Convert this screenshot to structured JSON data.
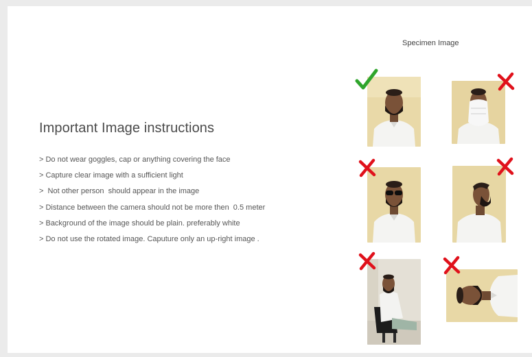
{
  "instructions": {
    "title": "Important Image instructions",
    "rules": [
      "> Do not wear goggles, cap or anything covering the face",
      "> Capture clear image with a sufficient light",
      ">  Not other person  should appear in the image",
      "> Distance between the camera should not be more then  0.5 meter",
      "> Background of the image should be plain. preferably white",
      "> Do not use the rotated image. Caputure only an up-right image ."
    ]
  },
  "specimen": {
    "label": "Specimen Image",
    "samples": [
      {
        "id": "correct-frontal",
        "status": "accepted",
        "mark_icon": "check-icon"
      },
      {
        "id": "face-covered",
        "status": "rejected",
        "mark_icon": "cross-icon"
      },
      {
        "id": "wearing-goggles",
        "status": "rejected",
        "mark_icon": "cross-icon"
      },
      {
        "id": "side-profile",
        "status": "rejected",
        "mark_icon": "cross-icon"
      },
      {
        "id": "too-far-seated",
        "status": "rejected",
        "mark_icon": "cross-icon"
      },
      {
        "id": "rotated-image",
        "status": "rejected",
        "mark_icon": "cross-icon"
      }
    ]
  },
  "colors": {
    "accept": "#2fa52c",
    "reject": "#e0111b"
  }
}
